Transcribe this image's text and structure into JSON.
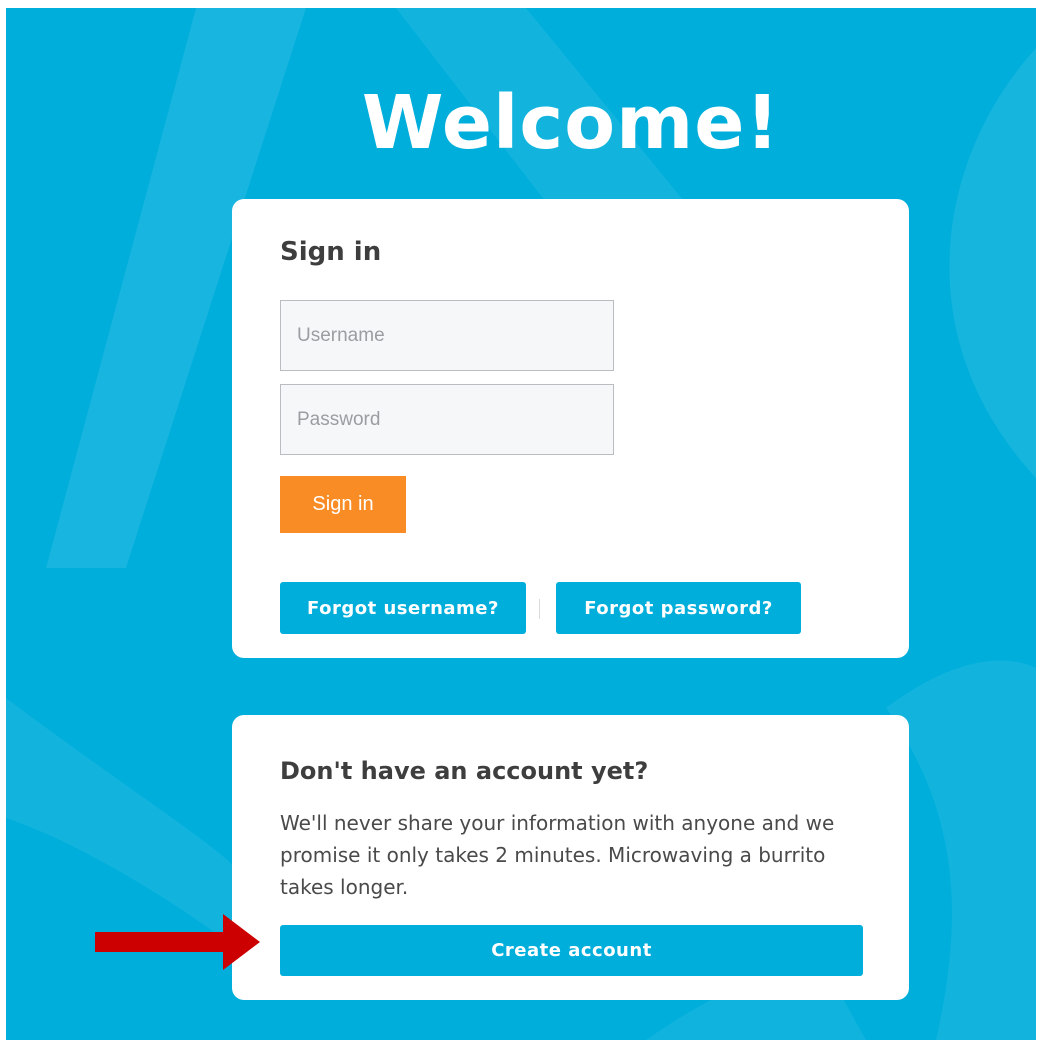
{
  "page": {
    "welcome_title": "Welcome!"
  },
  "signin": {
    "heading": "Sign in",
    "username_placeholder": "Username",
    "password_placeholder": "Password",
    "submit_label": "Sign in",
    "forgot_username_label": "Forgot username?",
    "forgot_password_label": "Forgot password?"
  },
  "signup": {
    "heading": "Don't have an account yet?",
    "description": "We'll never share your information with anyone and we promise it only takes 2 minutes. Microwaving a burrito takes longer.",
    "create_account_label": "Create account"
  },
  "annotation": {
    "arrow_icon": "right-arrow-icon",
    "arrow_color": "#cc0000"
  },
  "colors": {
    "background": "#00aedb",
    "primary_button": "#fa8c25",
    "secondary_button": "#00aedb",
    "card": "#ffffff"
  }
}
